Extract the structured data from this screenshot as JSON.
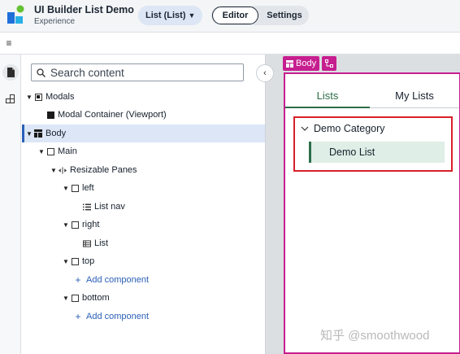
{
  "header": {
    "app_title": "UI Builder List Demo",
    "app_subtitle": "Experience",
    "page_select": "List (List)",
    "mode_editor": "Editor",
    "mode_settings": "Settings"
  },
  "search": {
    "placeholder": "Search content"
  },
  "outline": [
    {
      "label": "Modals",
      "icon": "container-framed-icon",
      "depth": 0,
      "expanded": true
    },
    {
      "label": "Modal Container (Viewport)",
      "icon": "modal-container-icon",
      "depth": 1,
      "expanded": null
    },
    {
      "label": "Body",
      "icon": "layout-grid-icon",
      "depth": 0,
      "expanded": true,
      "selected": true
    },
    {
      "label": "Main",
      "icon": "container-icon",
      "depth": 1,
      "expanded": true
    },
    {
      "label": "Resizable Panes",
      "icon": "resize-arrows-icon",
      "depth": 2,
      "expanded": true
    },
    {
      "label": "left",
      "icon": "container-icon",
      "depth": 3,
      "expanded": true
    },
    {
      "label": "List nav",
      "icon": "list-nav-icon",
      "depth": 4,
      "expanded": null
    },
    {
      "label": "right",
      "icon": "container-icon",
      "depth": 3,
      "expanded": true
    },
    {
      "label": "List",
      "icon": "list-table-icon",
      "depth": 4,
      "expanded": null
    },
    {
      "label": "top",
      "icon": "container-icon",
      "depth": 3,
      "expanded": true
    },
    {
      "label": "Add component",
      "icon": "plus-icon",
      "depth": 4,
      "add": true
    },
    {
      "label": "bottom",
      "icon": "container-icon",
      "depth": 3,
      "expanded": true
    },
    {
      "label": "Add component",
      "icon": "plus-icon",
      "depth": 4,
      "add": true
    }
  ],
  "canvas": {
    "breadcrumb_body": "Body",
    "tabs": [
      "Lists",
      "My Lists"
    ],
    "category_label": "Demo Category",
    "item_label": "Demo List"
  },
  "watermark": "知乎 @smoothwood",
  "colors": {
    "accent_blue": "#2b5fb8",
    "selection_bg": "#dce6f6",
    "magenta": "#c61e8f",
    "green": "#2c6e49",
    "highlight_red": "#d8202a"
  }
}
